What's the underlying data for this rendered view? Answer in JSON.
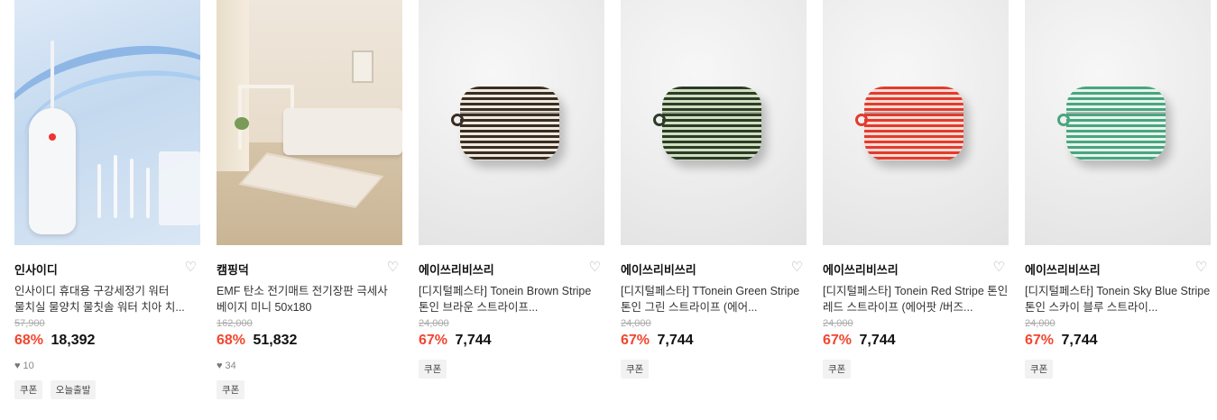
{
  "products": [
    {
      "brand": "인사이디",
      "title": "인사이디 휴대용 구강세정기 워터 물치실 물양치 물칫솔 워터 치아 치...",
      "original_price": "57,900",
      "discount": "68%",
      "price": "18,392",
      "likes": "10",
      "tags": [
        "쿠폰",
        "오늘출발"
      ]
    },
    {
      "brand": "캠핑덕",
      "title": "EMF 탄소 전기매트 전기장판 극세사 베이지 미니 50x180",
      "original_price": "162,000",
      "discount": "68%",
      "price": "51,832",
      "likes": "34",
      "tags": [
        "쿠폰"
      ]
    },
    {
      "brand": "에이쓰리비쓰리",
      "title": "[디지털페스타] Tonein Brown Stripe 톤인 브라운 스트라이프...",
      "original_price": "24,000",
      "discount": "67%",
      "price": "7,744",
      "tags": [
        "쿠폰"
      ]
    },
    {
      "brand": "에이쓰리비쓰리",
      "title": "[디지털페스타] TTonein Green Stripe 톤인 그린 스트라이프 (에어...",
      "original_price": "24,000",
      "discount": "67%",
      "price": "7,744",
      "tags": [
        "쿠폰"
      ]
    },
    {
      "brand": "에이쓰리비쓰리",
      "title": "[디지털페스타] Tonein Red Stripe 톤인 레드 스트라이프 (에어팟 /버즈...",
      "original_price": "24,000",
      "discount": "67%",
      "price": "7,744",
      "tags": [
        "쿠폰"
      ]
    },
    {
      "brand": "에이쓰리비쓰리",
      "title": "[디지털페스타] Tonein Sky Blue Stripe 톤인 스카이 블루 스트라이...",
      "original_price": "24,000",
      "discount": "67%",
      "price": "7,744",
      "tags": [
        "쿠폰"
      ]
    }
  ],
  "colors": {
    "discount": "#f2462f",
    "price": "#111111",
    "original_price": "#aaaaaa"
  }
}
